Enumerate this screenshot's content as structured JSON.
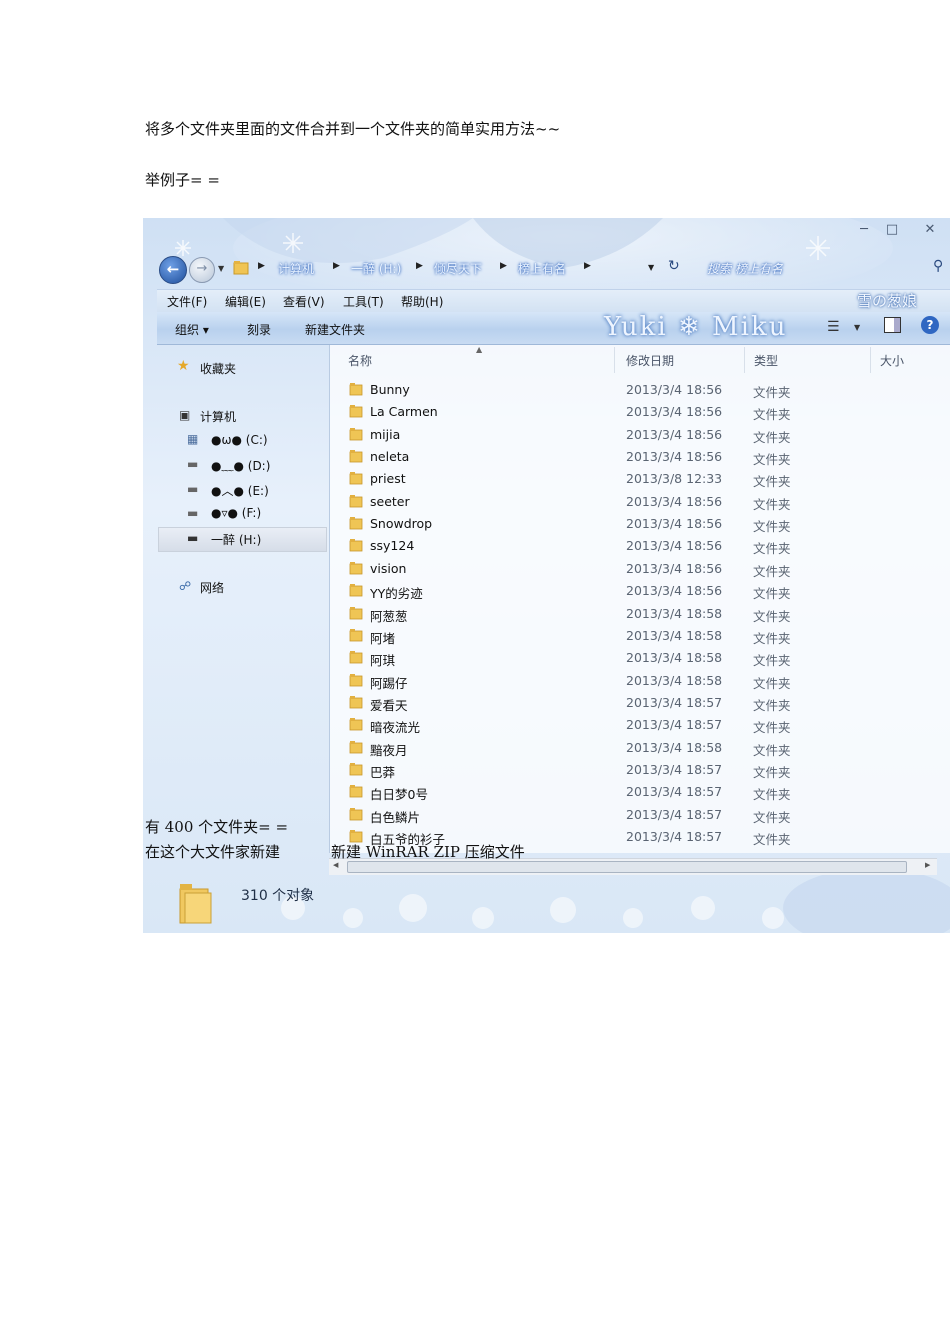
{
  "document": {
    "line1": "将多个文件夹里面的文件合并到一个文件夹的简单实用方法~~",
    "line2": "举例子= =",
    "line3": "有 400 个文件夹= =",
    "line4a": "在这个大文件家新建",
    "line4b": "新建 WinRAR ZIP 压缩文件"
  },
  "explorer": {
    "breadcrumb": [
      "计算机",
      "一醉 (H:)",
      "倾尽天下",
      "榜上有名"
    ],
    "search_placeholder": "搜索 榜上有名",
    "theme_text": "Yuki ❄ Miku",
    "theme_corner": "雪の葱娘",
    "menu": [
      "文件(F)",
      "编辑(E)",
      "查看(V)",
      "工具(T)",
      "帮助(H)"
    ],
    "toolbar": {
      "organize": "组织 ▾",
      "burn": "刻录",
      "new_folder": "新建文件夹"
    },
    "sidebar": {
      "favorites": "收藏夹",
      "computer": "计算机",
      "drives": [
        "●ω● (C:)",
        "●﹏● (D:)",
        "●︿● (E:)",
        "●▿● (F:)",
        "一醉 (H:)"
      ],
      "network": "网络"
    },
    "columns": {
      "name": "名称",
      "date": "修改日期",
      "type": "类型",
      "size": "大小"
    },
    "files": [
      {
        "name": "Bunny",
        "date": "2013/3/4 18:56",
        "type": "文件夹"
      },
      {
        "name": "La Carmen",
        "date": "2013/3/4 18:56",
        "type": "文件夹"
      },
      {
        "name": "mijia",
        "date": "2013/3/4 18:56",
        "type": "文件夹"
      },
      {
        "name": "neleta",
        "date": "2013/3/4 18:56",
        "type": "文件夹"
      },
      {
        "name": "priest",
        "date": "2013/3/8 12:33",
        "type": "文件夹"
      },
      {
        "name": "seeter",
        "date": "2013/3/4 18:56",
        "type": "文件夹"
      },
      {
        "name": "Snowdrop",
        "date": "2013/3/4 18:56",
        "type": "文件夹"
      },
      {
        "name": "ssy124",
        "date": "2013/3/4 18:56",
        "type": "文件夹"
      },
      {
        "name": "vision",
        "date": "2013/3/4 18:56",
        "type": "文件夹"
      },
      {
        "name": "YY的劣迹",
        "date": "2013/3/4 18:56",
        "type": "文件夹"
      },
      {
        "name": "阿葱葱",
        "date": "2013/3/4 18:58",
        "type": "文件夹"
      },
      {
        "name": "阿堵",
        "date": "2013/3/4 18:58",
        "type": "文件夹"
      },
      {
        "name": "阿琪",
        "date": "2013/3/4 18:58",
        "type": "文件夹"
      },
      {
        "name": "阿踢仔",
        "date": "2013/3/4 18:58",
        "type": "文件夹"
      },
      {
        "name": "爱看天",
        "date": "2013/3/4 18:57",
        "type": "文件夹"
      },
      {
        "name": "暗夜流光",
        "date": "2013/3/4 18:57",
        "type": "文件夹"
      },
      {
        "name": "黯夜月",
        "date": "2013/3/4 18:58",
        "type": "文件夹"
      },
      {
        "name": "巴莽",
        "date": "2013/3/4 18:57",
        "type": "文件夹"
      },
      {
        "name": "白日梦0号",
        "date": "2013/3/4 18:57",
        "type": "文件夹"
      },
      {
        "name": "白色鳞片",
        "date": "2013/3/4 18:57",
        "type": "文件夹"
      },
      {
        "name": "白五爷的衫子",
        "date": "2013/3/4 18:57",
        "type": "文件夹"
      }
    ],
    "status": "310 个对象"
  }
}
